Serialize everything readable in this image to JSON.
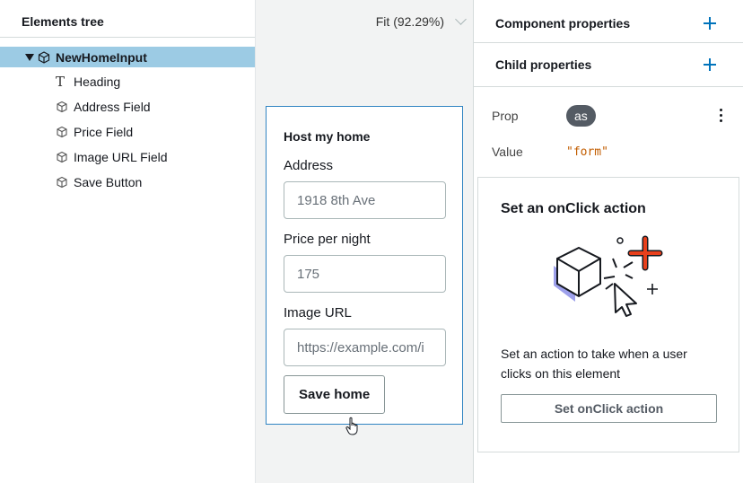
{
  "elements_tree": {
    "title": "Elements tree",
    "root": {
      "label": "NewHomeInput",
      "icon": "cube-icon"
    },
    "children": [
      {
        "label": "Heading",
        "icon": "text-icon"
      },
      {
        "label": "Address Field",
        "icon": "cube-icon"
      },
      {
        "label": "Price Field",
        "icon": "cube-icon"
      },
      {
        "label": "Image URL Field",
        "icon": "cube-icon"
      },
      {
        "label": "Save Button",
        "icon": "cube-icon"
      }
    ]
  },
  "canvas": {
    "zoom_label": "Fit (92.29%)",
    "preview": {
      "heading": "Host my home",
      "fields": [
        {
          "label": "Address",
          "value": "1918 8th Ave"
        },
        {
          "label": "Price per night",
          "value": "175"
        },
        {
          "label": "Image URL",
          "placeholder": "https://example.com/i"
        }
      ],
      "button": "Save home"
    }
  },
  "properties": {
    "component_properties": "Component properties",
    "child_properties": "Child properties",
    "prop_key": "Prop",
    "prop_value": "as",
    "value_key": "Value",
    "value_value": "\"form\"",
    "action": {
      "title": "Set an onClick action",
      "description": "Set an action to take when a user clicks on this element",
      "button": "Set onClick action"
    }
  },
  "colors": {
    "selected_row": "#9ccbe4",
    "accent_blue": "#0073bb",
    "plus_orange": "#e8401c",
    "code_orange": "#c25d00"
  }
}
